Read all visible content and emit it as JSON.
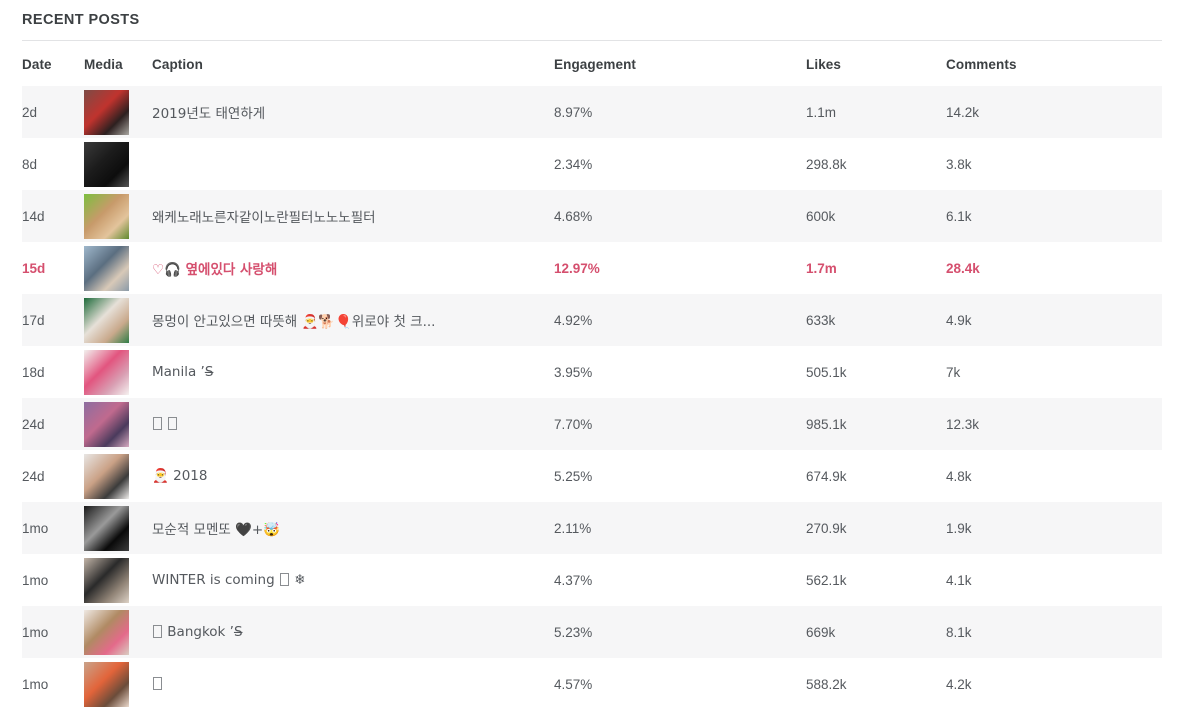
{
  "section": {
    "title": "RECENT POSTS"
  },
  "table": {
    "columns": [
      {
        "key": "date",
        "label": "Date"
      },
      {
        "key": "media",
        "label": "Media"
      },
      {
        "key": "caption",
        "label": "Caption"
      },
      {
        "key": "engagement",
        "label": "Engagement"
      },
      {
        "key": "likes",
        "label": "Likes"
      },
      {
        "key": "comments",
        "label": "Comments"
      }
    ],
    "highlight_color": "#d54f6e",
    "stripe_color": "#f6f6f7",
    "rows": [
      {
        "date": "2d",
        "media_alt": "post-thumbnail-woman-in-red-car",
        "caption": "2019년도 태연하게",
        "engagement": "8.97%",
        "likes": "1.1m",
        "comments": "14.2k",
        "highlighted": false,
        "thumb_colors": [
          "#7d4b46",
          "#c0332e",
          "#2d2020",
          "#a8a6a0"
        ]
      },
      {
        "date": "8d",
        "media_alt": "post-thumbnail-dark-portrait",
        "caption": "",
        "engagement": "2.34%",
        "likes": "298.8k",
        "comments": "3.8k",
        "highlighted": false,
        "thumb_colors": [
          "#3a3a3a",
          "#1b1b1b",
          "#0d0d0d",
          "#555555"
        ]
      },
      {
        "date": "14d",
        "media_alt": "post-thumbnail-blonde-woman-green-background",
        "caption": "왜케노래노른자같이노란필터노노노필터",
        "engagement": "4.68%",
        "likes": "600k",
        "comments": "6.1k",
        "highlighted": false,
        "thumb_colors": [
          "#7dbf3f",
          "#c79a6a",
          "#e3c49c",
          "#5f8a2e"
        ]
      },
      {
        "date": "15d",
        "media_alt": "post-thumbnail-man-by-the-sea",
        "caption": "♡🎧 옆에있다 사랑해",
        "engagement": "12.97%",
        "likes": "1.7m",
        "comments": "28.4k",
        "highlighted": true,
        "thumb_colors": [
          "#9fb8cc",
          "#5b6e80",
          "#d8c9b8",
          "#8a9aa8"
        ]
      },
      {
        "date": "17d",
        "media_alt": "post-thumbnail-woman-holding-white-dog",
        "caption": "몽멍이 안고있으면 따뜻해 🎅🐕🎈위로야 첫 크...",
        "engagement": "4.92%",
        "likes": "633k",
        "comments": "4.9k",
        "highlighted": false,
        "thumb_colors": [
          "#1d6a3a",
          "#e6e0d8",
          "#c9a98c",
          "#2f7d46"
        ]
      },
      {
        "date": "18d",
        "media_alt": "post-thumbnail-pink-banner-photo",
        "caption": "Manila ’S̶",
        "engagement": "3.95%",
        "likes": "505.1k",
        "comments": "7k",
        "highlighted": false,
        "thumb_colors": [
          "#f2f0ee",
          "#e2557f",
          "#d9a0b4",
          "#f6f2f0"
        ]
      },
      {
        "date": "24d",
        "media_alt": "post-thumbnail-christmas-lights",
        "caption": "TOFU TOFU",
        "engagement": "7.70%",
        "likes": "985.1k",
        "comments": "12.3k",
        "highlighted": false,
        "thumb_colors": [
          "#8d6ea0",
          "#c06a8e",
          "#4a3a5c",
          "#d6a9c0"
        ]
      },
      {
        "date": "24d",
        "media_alt": "post-thumbnail-woman-with-bun-hairstyle",
        "caption": "🎅 2018",
        "engagement": "5.25%",
        "likes": "674.9k",
        "comments": "4.8k",
        "highlighted": false,
        "thumb_colors": [
          "#e8e6e4",
          "#caa186",
          "#3b3b3b",
          "#f0eeec"
        ]
      },
      {
        "date": "1mo",
        "media_alt": "post-thumbnail-black-and-white-room",
        "caption": "모순적 모멘또 🖤+🤯",
        "engagement": "2.11%",
        "likes": "270.9k",
        "comments": "1.9k",
        "highlighted": false,
        "thumb_colors": [
          "#1a1a1a",
          "#9a9a9a",
          "#0a0a0a",
          "#3d3d3d"
        ]
      },
      {
        "date": "1mo",
        "media_alt": "post-thumbnail-woman-in-hallway",
        "caption": "WINTER is coming TOFU ❄",
        "engagement": "4.37%",
        "likes": "562.1k",
        "comments": "4.1k",
        "highlighted": false,
        "thumb_colors": [
          "#c3b5a8",
          "#2a2a2a",
          "#8f8275",
          "#ddd2c6"
        ]
      },
      {
        "date": "1mo",
        "media_alt": "post-thumbnail-woman-holding-sign",
        "caption": "TOFU Bangkok ’S̶",
        "engagement": "5.23%",
        "likes": "669k",
        "comments": "8.1k",
        "highlighted": false,
        "thumb_colors": [
          "#efe9e3",
          "#b08a63",
          "#e46a8a",
          "#d9cec2"
        ]
      },
      {
        "date": "1mo",
        "media_alt": "post-thumbnail-woman-in-orange-outfit",
        "caption": "TOFU",
        "engagement": "4.57%",
        "likes": "588.2k",
        "comments": "4.2k",
        "highlighted": false,
        "thumb_colors": [
          "#c9a38a",
          "#e2643a",
          "#6b4c3a",
          "#ead9cc"
        ]
      }
    ]
  }
}
